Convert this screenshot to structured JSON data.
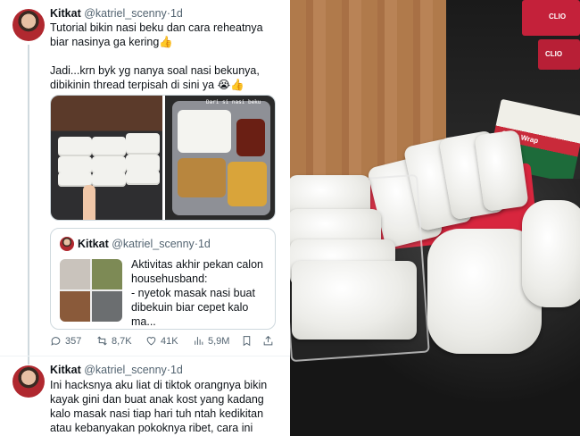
{
  "tweets": [
    {
      "name": "Kitkat",
      "handle": "@katriel_scenny",
      "time": "1d",
      "text": "Tutorial bikin nasi beku dan cara reheatnya biar nasinya ga kering👍\n\nJadi...krn byk yg nanya soal nasi bekunya, dibikinin thread terpisah di sini ya 😭👍"
    },
    {
      "name": "Kitkat",
      "handle": "@katriel_scenny",
      "time": "1d",
      "text": "Ini hacksnya aku liat di tiktok orangnya bikin kayak gini dan buat anak kost yang kadang kalo masak nasi tiap hari tuh ntah kedikitan atau kebanyakan pokoknya ribet, cara ini"
    }
  ],
  "media_photo_label": "Dari si nasi beku",
  "quote": {
    "name": "Kitkat",
    "handle": "@katriel_scenny",
    "time": "1d",
    "text": "Aktivitas akhir pekan calon househusband:\n- nyetok masak nasi buat dibekuin biar cepet kalo ma..."
  },
  "actions": {
    "replies": "357",
    "retweets": "8,7K",
    "likes": "41K",
    "views": "5,9M"
  },
  "photo": {
    "box_label_1": "Cling Wrap",
    "box_label_2": "CLIO",
    "box_label_3": "CLIO"
  },
  "colors": {
    "text": "#0f1419",
    "secondary": "#536471",
    "border": "#cfd9de",
    "red_container": "#d8263e"
  }
}
